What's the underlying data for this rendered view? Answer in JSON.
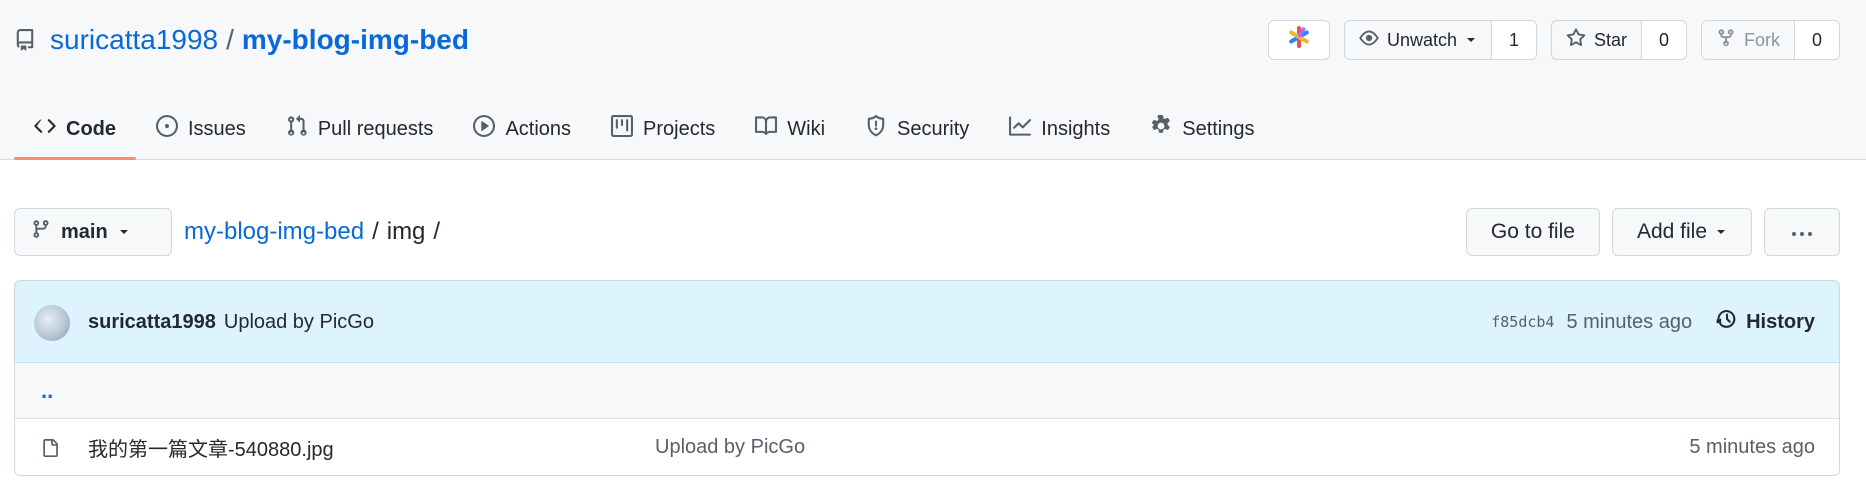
{
  "repo": {
    "owner": "suricatta1998",
    "separator": "/",
    "name": "my-blog-img-bed"
  },
  "top_actions": {
    "apps_icon": "colorful-asterisk-icon",
    "watch": {
      "label": "Unwatch",
      "count": "1"
    },
    "star": {
      "label": "Star",
      "count": "0"
    },
    "fork": {
      "label": "Fork",
      "count": "0"
    }
  },
  "tabs": [
    {
      "label": "Code",
      "icon": "code-icon",
      "active": true
    },
    {
      "label": "Issues",
      "icon": "issue-icon"
    },
    {
      "label": "Pull requests",
      "icon": "pull-request-icon"
    },
    {
      "label": "Actions",
      "icon": "play-icon"
    },
    {
      "label": "Projects",
      "icon": "project-icon"
    },
    {
      "label": "Wiki",
      "icon": "book-icon"
    },
    {
      "label": "Security",
      "icon": "shield-icon"
    },
    {
      "label": "Insights",
      "icon": "graph-icon"
    },
    {
      "label": "Settings",
      "icon": "gear-icon"
    }
  ],
  "toolbar": {
    "branch": "main",
    "breadcrumb_repo": "my-blog-img-bed",
    "breadcrumb_dir": "img",
    "slash": "/",
    "go_to_file": "Go to file",
    "add_file": "Add file"
  },
  "commit": {
    "author": "suricatta1998",
    "message": "Upload by PicGo",
    "sha": "f85dcb4",
    "time": "5 minutes ago",
    "history": "History"
  },
  "parent_dir": "..",
  "files": [
    {
      "name": "我的第一篇文章-540880.jpg",
      "message": "Upload by PicGo",
      "time": "5 minutes ago"
    }
  ],
  "colors": {
    "link": "#0969da",
    "tab_underline": "#fd8c73",
    "commit_bg": "#ddf4ff"
  }
}
